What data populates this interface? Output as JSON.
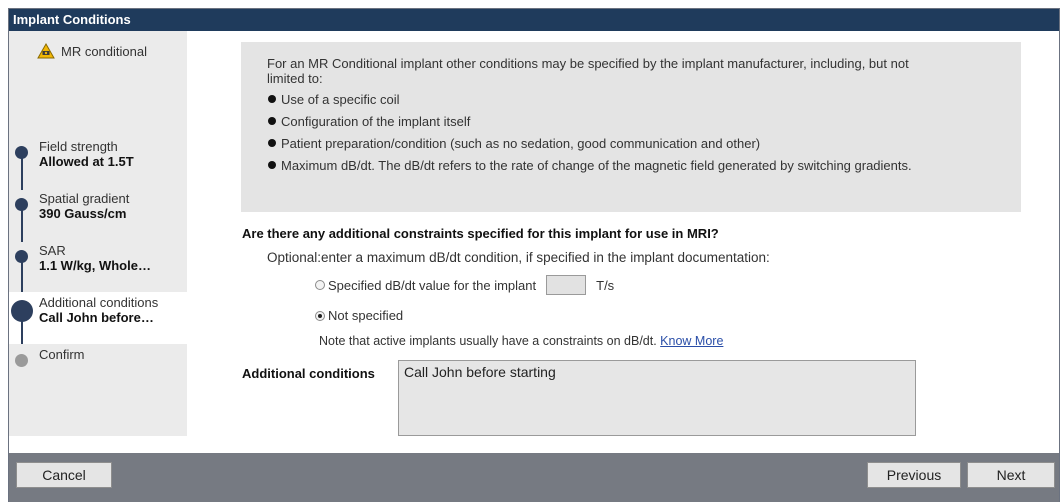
{
  "window": {
    "title": "Implant Conditions"
  },
  "sidebar": {
    "status_label": "MR conditional",
    "steps": [
      {
        "label": "Field strength",
        "value": "Allowed at 1.5T"
      },
      {
        "label": "Spatial gradient",
        "value": "390 Gauss/cm"
      },
      {
        "label": "SAR",
        "value": "1.1 W/kg, Whole…"
      },
      {
        "label": "Additional conditions",
        "value": "Call John before…"
      },
      {
        "label": "Confirm",
        "value": ""
      }
    ]
  },
  "info": {
    "intro": "For an MR Conditional implant other conditions may be specified by the implant manufacturer, including, but not limited to:",
    "bullets": [
      "Use of a specific coil",
      "Configuration of the implant itself",
      "Patient preparation/condition (such as no sedation, good communication and other)",
      "Maximum dB/dt. The dB/dt refers to the rate of change of the magnetic field generated by switching gradients."
    ]
  },
  "form": {
    "question": "Are there any additional constraints specified for this implant for use in MRI?",
    "optional_text": "Optional:enter a maximum dB/dt condition, if specified in the implant documentation:",
    "option_specified": "Specified dB/dt value for the implant",
    "dbdt_value": "",
    "unit": "T/s",
    "option_not_specified": "Not specified",
    "selected_option": "Not specified",
    "note": "Note that active implants usually have a constraints on dB/dt.",
    "know_more": "Know More",
    "additional_label": "Additional conditions",
    "additional_value": "Call John before starting"
  },
  "footer": {
    "cancel": "Cancel",
    "previous": "Previous",
    "next": "Next"
  },
  "colors": {
    "titlebar": "#1f3b5c",
    "step_dot": "#2d3f5e",
    "footer": "#767a82",
    "link": "#2a4ea8",
    "warning": "#f2b705"
  },
  "icons": {
    "status": "warning-triangle-icon"
  }
}
